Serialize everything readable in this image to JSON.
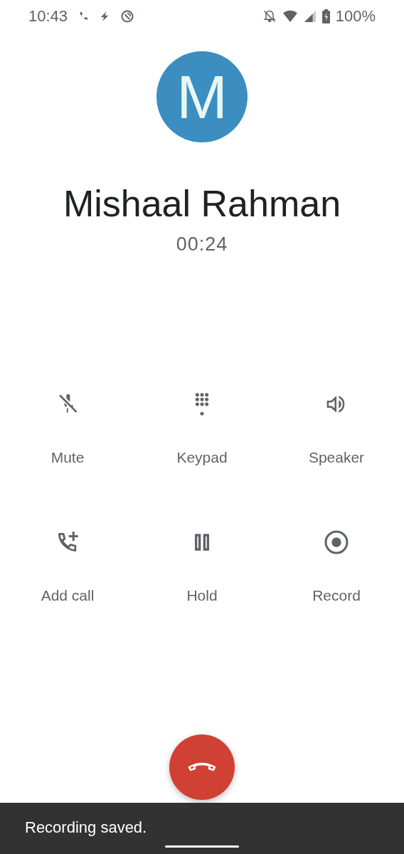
{
  "status_bar": {
    "time": "10:43",
    "battery": "100%"
  },
  "contact": {
    "initial": "M",
    "name": "Mishaal Rahman",
    "duration": "00:24"
  },
  "controls": [
    {
      "kind": "mute",
      "label": "Mute"
    },
    {
      "kind": "keypad",
      "label": "Keypad"
    },
    {
      "kind": "speaker",
      "label": "Speaker"
    },
    {
      "kind": "add_call",
      "label": "Add call"
    },
    {
      "kind": "hold",
      "label": "Hold"
    },
    {
      "kind": "record",
      "label": "Record"
    }
  ],
  "snackbar": {
    "message": "Recording saved."
  }
}
